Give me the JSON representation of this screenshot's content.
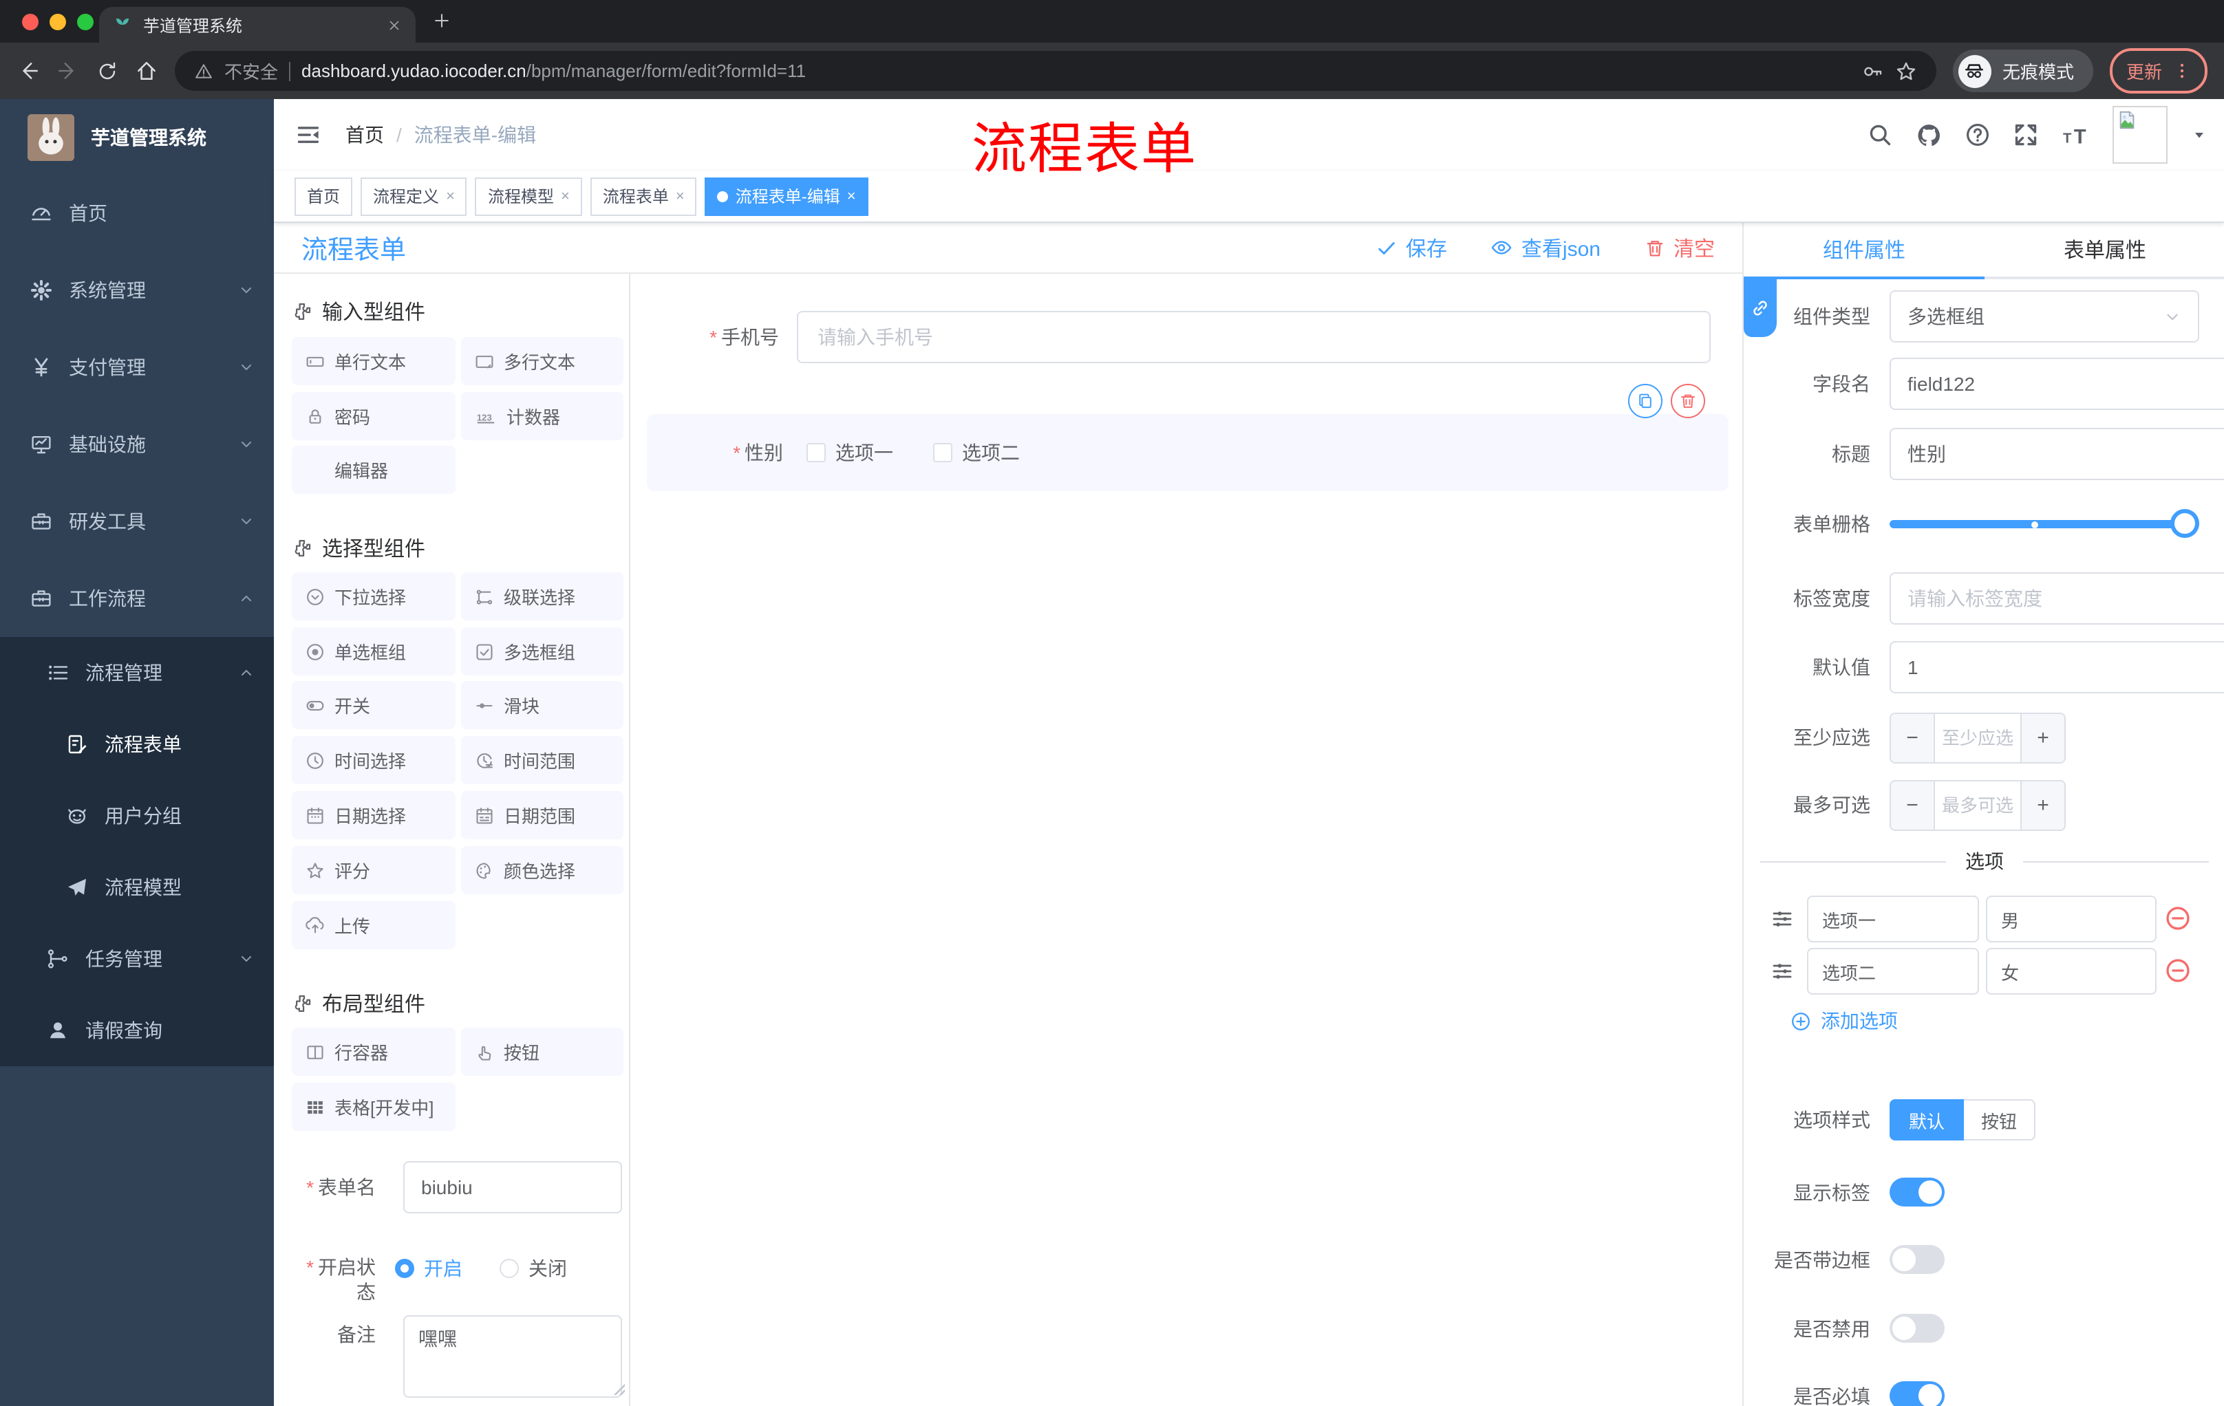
{
  "browser": {
    "tab_title": "芋道管理系统",
    "security_label": "不安全",
    "url_host": "dashboard.yudao.iocoder.cn",
    "url_path": "/bpm/manager/form/edit?formId=11",
    "incognito_label": "无痕模式",
    "update_label": "更新"
  },
  "annotation": {
    "text": "流程表单"
  },
  "sidebar": {
    "title": "芋道管理系统",
    "items": [
      {
        "label": "首页"
      },
      {
        "label": "系统管理"
      },
      {
        "label": "支付管理"
      },
      {
        "label": "基础设施"
      },
      {
        "label": "研发工具"
      },
      {
        "label": "工作流程"
      },
      {
        "label": "流程管理"
      },
      {
        "label": "流程表单"
      },
      {
        "label": "用户分组"
      },
      {
        "label": "流程模型"
      },
      {
        "label": "任务管理"
      },
      {
        "label": "请假查询"
      }
    ]
  },
  "breadcrumb": {
    "home": "首页",
    "sep": "/",
    "current": "流程表单-编辑"
  },
  "tags": [
    {
      "label": "首页"
    },
    {
      "label": "流程定义"
    },
    {
      "label": "流程模型"
    },
    {
      "label": "流程表单"
    },
    {
      "label": "流程表单-编辑"
    }
  ],
  "toolbar": {
    "title": "流程表单",
    "save": "保存",
    "view_json": "查看json",
    "clear": "清空"
  },
  "palette": {
    "sections": [
      {
        "title": "输入型组件",
        "items": [
          "单行文本",
          "多行文本",
          "密码",
          "计数器",
          "编辑器"
        ]
      },
      {
        "title": "选择型组件",
        "items": [
          "下拉选择",
          "级联选择",
          "单选框组",
          "多选框组",
          "开关",
          "滑块",
          "时间选择",
          "时间范围",
          "日期选择",
          "日期范围",
          "评分",
          "颜色选择",
          "上传"
        ]
      },
      {
        "title": "布局型组件",
        "items": [
          "行容器",
          "按钮",
          "表格[开发中]"
        ]
      }
    ],
    "form": {
      "name_label": "表单名",
      "name_value": "biubiu",
      "status_label": "开启状态",
      "status_on": "开启",
      "status_off": "关闭",
      "remark_label": "备注",
      "remark_value": "嘿嘿"
    }
  },
  "canvas": {
    "phone_label": "手机号",
    "phone_placeholder": "请输入手机号",
    "gender_label": "性别",
    "gender_opt1": "选项一",
    "gender_opt2": "选项二"
  },
  "props": {
    "tab_component": "组件属性",
    "tab_form": "表单属性",
    "type_label": "组件类型",
    "type_value": "多选框组",
    "field_label": "字段名",
    "field_value": "field122",
    "title_label": "标题",
    "title_value": "性别",
    "grid_label": "表单栅格",
    "width_label": "标签宽度",
    "width_placeholder": "请输入标签宽度",
    "default_label": "默认值",
    "default_value": "1",
    "min_label": "至少应选",
    "min_placeholder": "至少应选",
    "max_label": "最多可选",
    "max_placeholder": "最多可选",
    "options_divider": "选项",
    "options": [
      {
        "label": "选项一",
        "value": "男"
      },
      {
        "label": "选项二",
        "value": "女"
      }
    ],
    "add_option": "添加选项",
    "style_label": "选项样式",
    "style_default": "默认",
    "style_button": "按钮",
    "show_label": "显示标签",
    "border_label": "是否带边框",
    "disabled_label": "是否禁用",
    "required_label": "是否必填"
  }
}
